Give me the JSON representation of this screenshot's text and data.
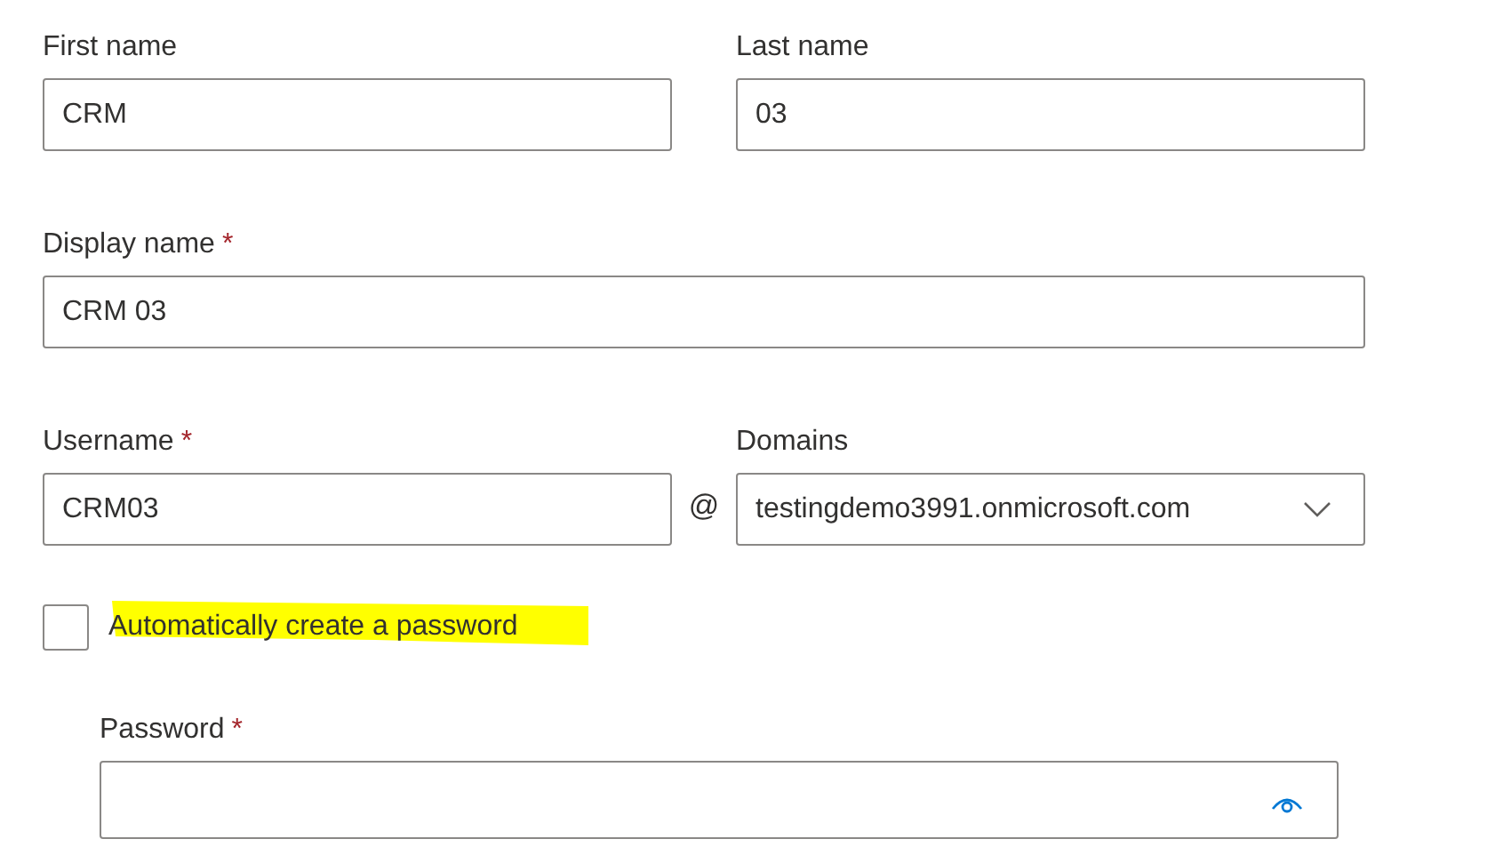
{
  "name_fields": [
    {
      "label": "First name",
      "value": "CRM"
    },
    {
      "label": "Last name",
      "value": "03"
    }
  ],
  "display_name": {
    "label": "Display name",
    "required_mark": "*",
    "value": "CRM 03"
  },
  "username": {
    "label": "Username",
    "required_mark": "*",
    "value": "CRM03"
  },
  "at_sign": "@",
  "domains": {
    "label": "Domains",
    "value": "testingdemo3991.onmicrosoft.com"
  },
  "auto_password": {
    "label": "Automatically create a password",
    "checked": false,
    "highlighted": true
  },
  "password": {
    "label": "Password",
    "required_mark": "*"
  }
}
